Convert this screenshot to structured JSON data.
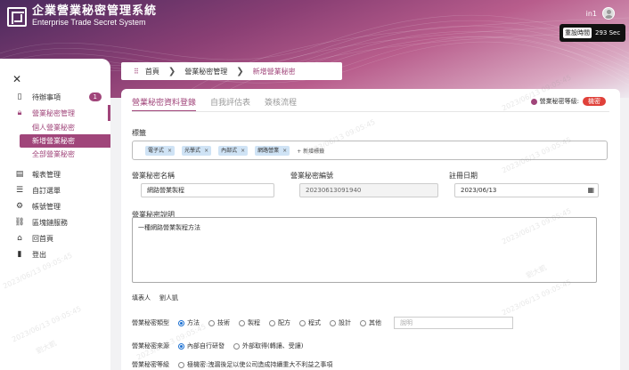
{
  "header": {
    "title_zh": "企業營業秘密管理系統",
    "title_en": "Enterprise Trade Secret System",
    "user": "in1",
    "timer_label": "重設時間",
    "timer_value": "293 Sec"
  },
  "sidebar": {
    "items": [
      {
        "label": "待辦事項",
        "icon": "desk-icon",
        "badge": "1"
      },
      {
        "label": "營業秘密管理",
        "icon": "lock-icon"
      },
      {
        "label": "報表管理",
        "icon": "report-icon"
      },
      {
        "label": "自訂選單",
        "icon": "list-icon"
      },
      {
        "label": "帳號管理",
        "icon": "gear-icon"
      },
      {
        "label": "區塊鏈服務",
        "icon": "chain-icon"
      },
      {
        "label": "回首頁",
        "icon": "home-icon"
      },
      {
        "label": "登出",
        "icon": "logout-icon"
      }
    ],
    "subitems": [
      "個人營業秘密",
      "新增營業秘密",
      "全部營業秘密"
    ]
  },
  "breadcrumb": [
    "首頁",
    "營業秘密管理",
    "新增營業秘密"
  ],
  "tabs": [
    "營業秘密資料登錄",
    "自我評估表",
    "簽核流程"
  ],
  "urgency": {
    "label": "營業秘密等級:",
    "value": "機密"
  },
  "form": {
    "tags_label": "標籤",
    "tags": [
      "電子式",
      "光學式",
      "內部式",
      "網路營業"
    ],
    "tag_add": "+ 新增標籤",
    "name_label": "營業秘密名稱",
    "name_value": "網路營業製程",
    "id_label": "營業秘密編號",
    "id_value": "20230613091940",
    "date_label": "註冊日期",
    "date_value": "2023/06/13",
    "desc_label": "營業秘密說明",
    "desc_value": "一種網路營業製程方法",
    "filler_label": "填表人",
    "filler_value": "劉人凱",
    "type_label": "營業秘密類型",
    "type_options": [
      "方法",
      "技術",
      "製程",
      "配方",
      "程式",
      "設計",
      "其他"
    ],
    "type_selected": 0,
    "type_note_placeholder": "說明",
    "source_label": "營業秘密來源",
    "source_options": [
      "內部自行研發",
      "外部取得(轉讓、受讓)"
    ],
    "source_selected": 0,
    "level_label": "營業秘密等級",
    "level_text": "極機密:洩漏後足以使公司造成持續重大不利益之事項"
  },
  "watermark": "2023/06/13 09:05:45",
  "watermark_name": "劉大凱"
}
